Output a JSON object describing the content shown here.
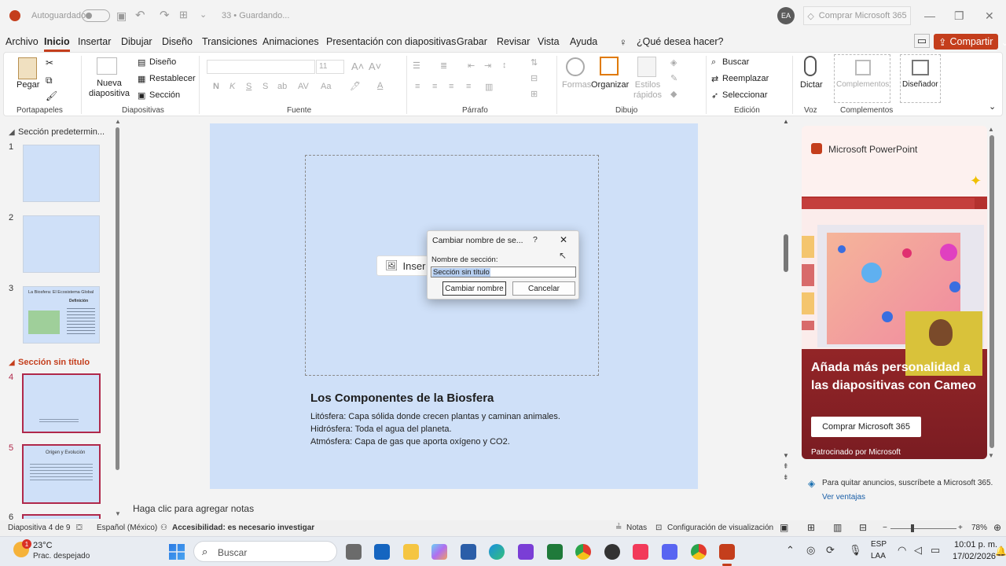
{
  "titlebar": {
    "autosave_label": "Autoguardado",
    "doc_status": "33 • Guardando...",
    "user_initials": "EA",
    "buy_button": "Comprar Microsoft 365"
  },
  "menu": {
    "tabs": [
      "Archivo",
      "Inicio",
      "Insertar",
      "Dibujar",
      "Diseño",
      "Transiciones",
      "Animaciones",
      "Presentación con diapositivas",
      "Grabar",
      "Revisar",
      "Vista",
      "Ayuda"
    ],
    "active_tab": "Inicio",
    "search": "¿Qué desea hacer?",
    "share": "Compartir"
  },
  "ribbon": {
    "portapapeles": {
      "paste": "Pegar",
      "group": "Portapapeles"
    },
    "diapositivas": {
      "new_slide": "Nueva diapositiva",
      "design": "Diseño",
      "reset": "Restablecer",
      "section": "Sección",
      "group": "Diapositivas"
    },
    "fuente": {
      "font_size": "11",
      "group": "Fuente"
    },
    "parrafo": {
      "group": "Párrafo"
    },
    "dibujo": {
      "shapes": "Formas",
      "arrange": "Organizar",
      "quick_styles": "Estilos rápidos",
      "group": "Dibujo"
    },
    "edicion": {
      "find": "Buscar",
      "replace": "Reemplazar",
      "select": "Seleccionar",
      "group": "Edición"
    },
    "voz": {
      "dictate": "Dictar",
      "group": "Voz"
    },
    "complementos": {
      "addins": "Complementos",
      "designer": "Diseñador",
      "group": "Complementos"
    }
  },
  "slides_panel": {
    "section1": "Sección predetermin...",
    "section2": "Sección sin título",
    "slide_numbers": [
      "1",
      "2",
      "3",
      "4",
      "5",
      "6"
    ],
    "slide3_title": "La Biosfera: El Ecosistema Global",
    "slide3_subtitle": "Definición",
    "slide5_title": "Origen y Evolución"
  },
  "slide": {
    "insert_hint": "Inser",
    "title": "Los Componentes de la Biosfera",
    "bullets": [
      "Litósfera: Capa sólida donde crecen plantas y caminan animales.",
      "Hidrósfera: Toda el agua del planeta.",
      "Atmósfera: Capa de gas que aporta oxígeno y CO2."
    ]
  },
  "dialog": {
    "title": "Cambiar nombre de se...",
    "help": "?",
    "field_label": "Nombre de sección:",
    "field_value": "Sección sin título",
    "ok": "Cambiar nombre",
    "cancel": "Cancelar"
  },
  "ad": {
    "brand": "Microsoft PowerPoint",
    "headline": "Añada más personalidad a las diapositivas con Cameo",
    "cta": "Comprar Microsoft 365",
    "sponsor": "Patrocinado por Microsoft",
    "remove_ads": "Para quitar anuncios, suscríbete a Microsoft 365.",
    "see_benefits": "Ver ventajas"
  },
  "notes_placeholder": "Haga clic para agregar notas",
  "status": {
    "slide_count": "Diapositiva 4 de 9",
    "language": "Español (México)",
    "accessibility": "Accesibilidad: es necesario investigar",
    "notes": "Notas",
    "view_settings": "Configuración de visualización",
    "zoom": "78%"
  },
  "taskbar": {
    "weather_temp": "23°C",
    "weather_desc": "Prac. despejado",
    "weather_badge": "1",
    "search": "Buscar",
    "lang": "ESP",
    "kbd": "LAA",
    "time": "10:01 p. m.",
    "date": "17/02/2026"
  },
  "colors": {
    "accent": "#c43e1c",
    "slide_bg": "#cfe0f8",
    "selected_thumb": "#b0284a"
  }
}
